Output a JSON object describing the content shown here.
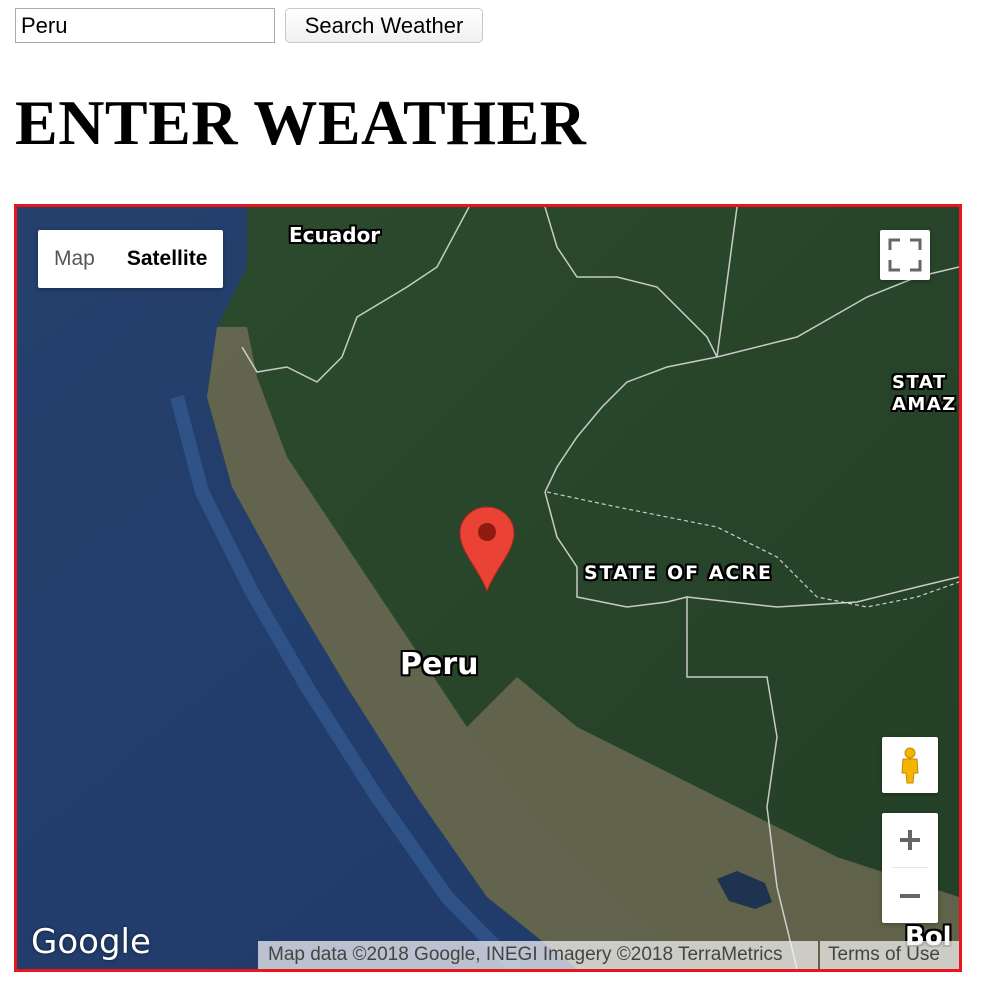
{
  "search": {
    "value": "Peru",
    "button_label": "Search Weather"
  },
  "page": {
    "title": "ENTER WEATHER"
  },
  "map": {
    "frame_color": "#e8141e",
    "type_control": {
      "map_label": "Map",
      "satellite_label": "Satellite",
      "selected": "Satellite"
    },
    "labels": {
      "ecuador": "Ecuador",
      "acre": "STATE OF ACRE",
      "peru": "Peru",
      "amazonas_line1": "STAT",
      "amazonas_line2": "AMAZ",
      "bolivia": "Bol"
    },
    "marker": {
      "icon": "map-marker-icon",
      "color": "#ea4335"
    },
    "controls": {
      "fullscreen_icon": "fullscreen-icon",
      "pegman_icon": "pegman-icon",
      "zoom_in_icon": "plus-icon",
      "zoom_out_icon": "minus-icon"
    },
    "google_logo": "Google",
    "attribution": "Map data ©2018 Google, INEGI Imagery ©2018 TerraMetrics",
    "terms_label": "Terms of Use"
  }
}
